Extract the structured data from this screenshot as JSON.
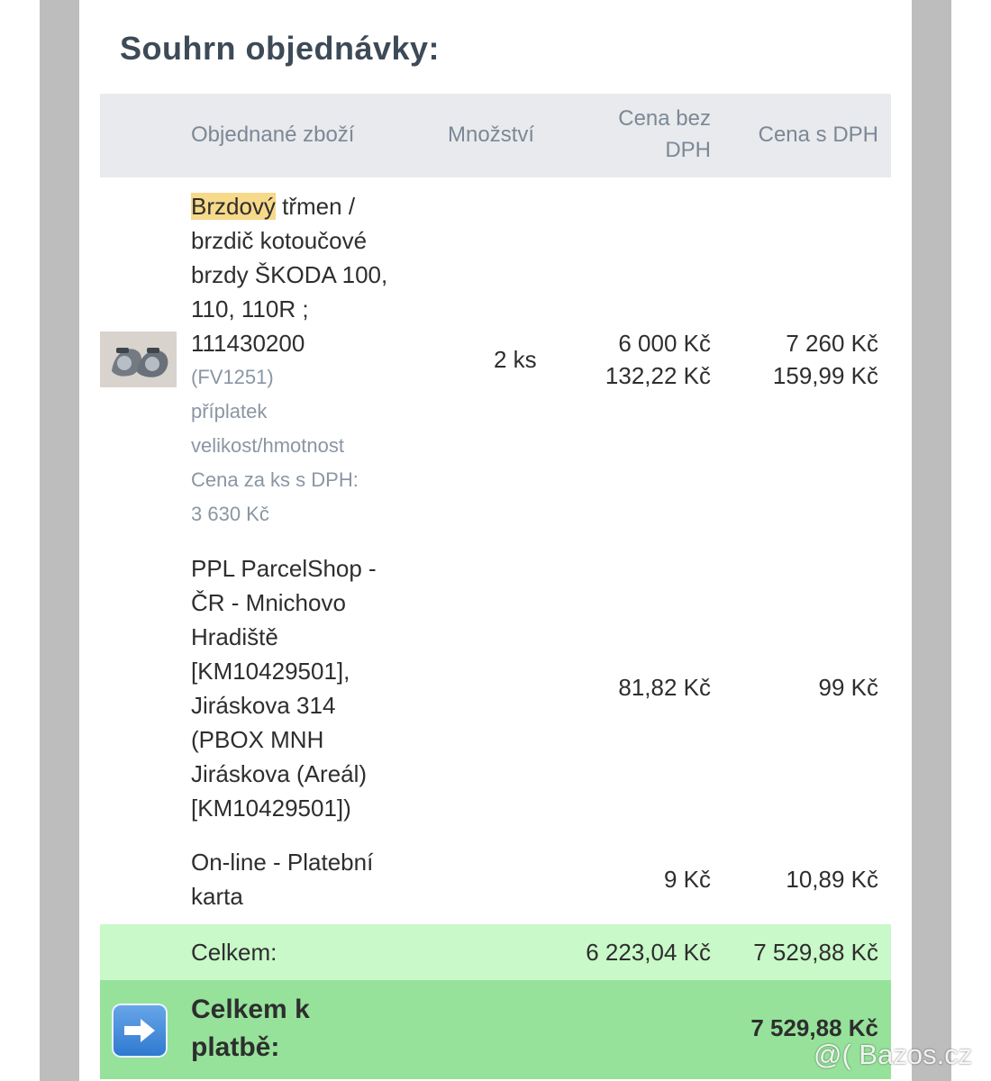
{
  "page": {
    "title": "Souhrn objednávky:"
  },
  "table": {
    "headers": {
      "item": "Objednané zboží",
      "qty": "Množství",
      "price_wo_vat_line1": "Cena bez",
      "price_wo_vat_line2": "DPH",
      "price_with_vat": "Cena s DPH"
    },
    "product": {
      "highlight_word": "Brzdový",
      "name_lines": [
        " třmen /",
        "brzdič kotoučové",
        "brzdy ŠKODA 100,",
        "110, 110R ;",
        "111430200"
      ],
      "muted_lines": [
        "(FV1251)",
        "příplatek",
        "velikost/hmotnost",
        "Cena za ks s DPH:",
        "3 630 Kč"
      ],
      "qty": "2 ks",
      "price_wo_vat": "6 000 Kč",
      "price_wo_vat_extra": "132,22 Kč",
      "price_with_vat": "7 260 Kč",
      "price_with_vat_extra": "159,99 Kč"
    },
    "shipping": {
      "lines": [
        "PPL ParcelShop -",
        "ČR - Mnichovo",
        "Hradiště",
        "[KM10429501],",
        "Jiráskova 314",
        "(PBOX MNH",
        "Jiráskova (Areál)",
        "[KM10429501])"
      ],
      "price_wo_vat": "81,82 Kč",
      "price_with_vat": "99 Kč"
    },
    "payment": {
      "lines": [
        "On-line - Platební",
        "karta"
      ],
      "price_wo_vat": "9 Kč",
      "price_with_vat": "10,89 Kč"
    },
    "subtotal": {
      "label": "Celkem:",
      "price_wo_vat": "6 223,04 Kč",
      "price_with_vat": "7 529,88 Kč"
    },
    "grand_total": {
      "label_line1": "Celkem k",
      "label_line2": "platbě:",
      "price_with_vat": "7 529,88 Kč"
    }
  },
  "icons": {
    "arrow": "right-arrow-icon"
  },
  "watermark": "@( Bazos.cz",
  "colors": {
    "header_bg": "#e8eaed",
    "subtotal_bg": "#c9f8c9",
    "total_bg": "#96e29a",
    "highlight": "#f7d98a"
  }
}
